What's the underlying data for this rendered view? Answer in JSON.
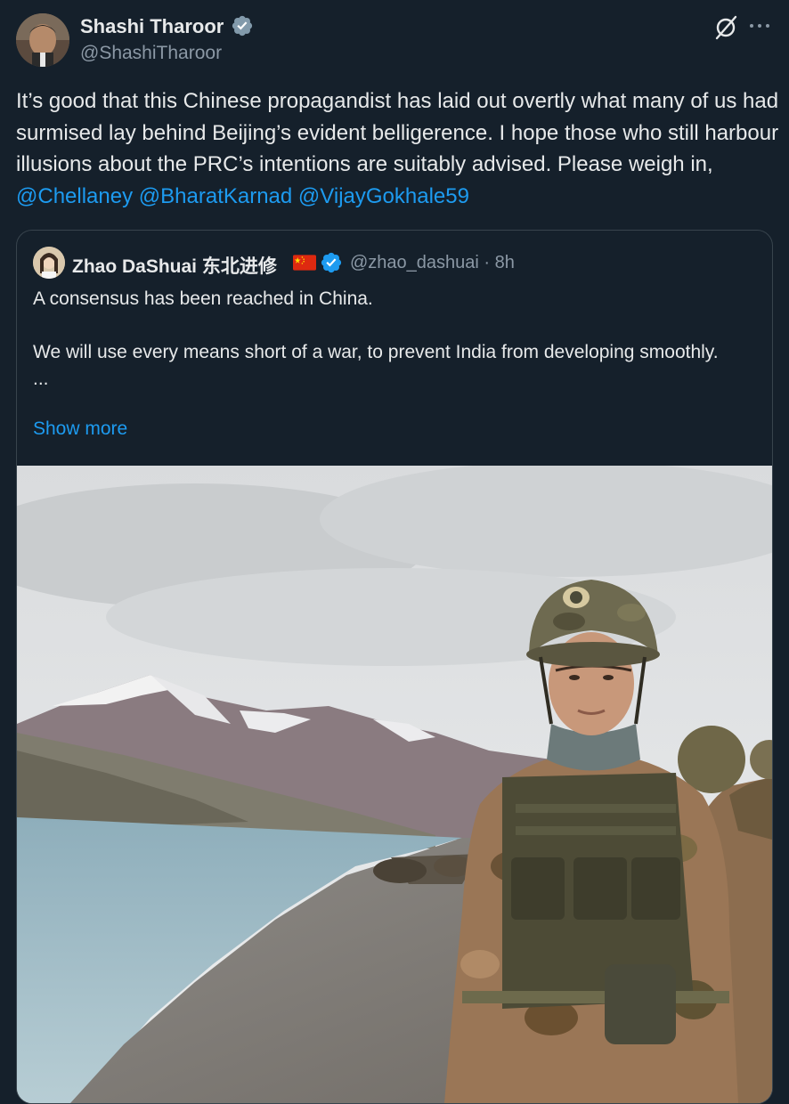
{
  "author": {
    "name": "Shashi Tharoor",
    "handle": "@ShashiTharoor",
    "verified": "gray"
  },
  "tweet": {
    "text_main": "It’s good that this Chinese propagandist has laid out overtly what many of us had surmised lay behind Beijing’s evident belligerence. I hope those who still harbour illusions about the PRC’s intentions are suitably advised. Please weigh in, ",
    "mentions": [
      "@Chellaney",
      "@BharatKarnad",
      "@VijayGokhale59"
    ]
  },
  "quoted": {
    "name": "Zhao DaShuai 东北进修",
    "flag": "china-flag",
    "verified": "blue",
    "handle": "@zhao_dashuai",
    "time": "· 8h",
    "text": "A consensus has been reached in China.\n\nWe will use every means short of a war, to prevent India from developing smoothly.\n...",
    "show_more": "Show more"
  },
  "colors": {
    "background": "#15202b",
    "text": "#e7e9ea",
    "secondary": "#8b98a5",
    "link": "#1d9bf0",
    "border": "#38444d"
  },
  "icons": [
    "grok-icon",
    "more-icon",
    "verified-badge-icon",
    "china-flag-icon"
  ]
}
